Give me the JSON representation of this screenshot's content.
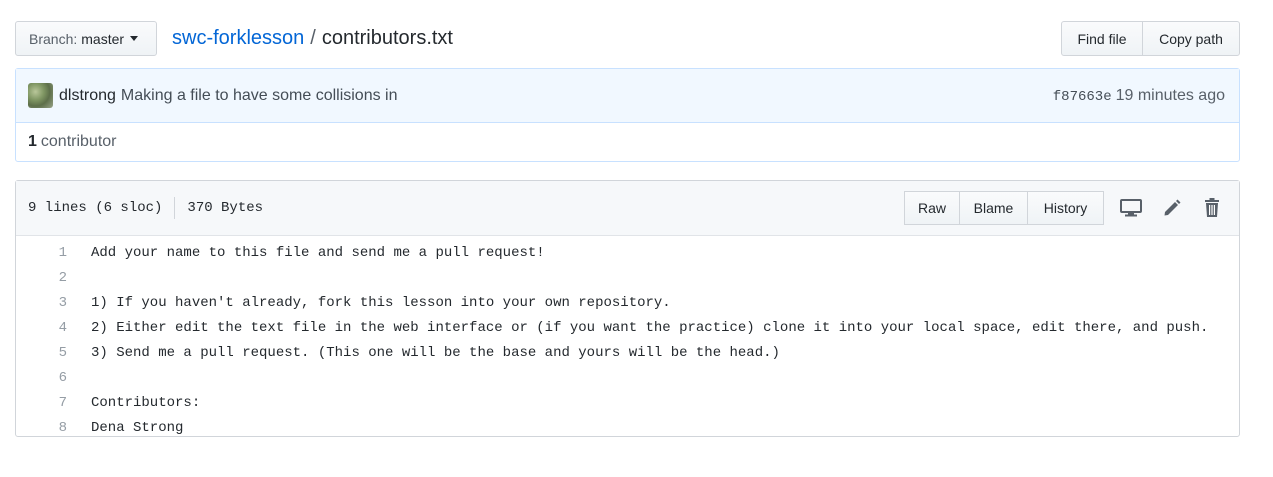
{
  "branch": {
    "label": "Branch:",
    "value": "master"
  },
  "breadcrumb": {
    "repo": "swc-forklesson",
    "separator": "/",
    "file": "contributors.txt"
  },
  "top_actions": {
    "find_file": "Find file",
    "copy_path": "Copy path"
  },
  "commit": {
    "author": "dlstrong",
    "message": "Making a file to have some collisions in",
    "sha": "f87663e",
    "time": "19 minutes ago"
  },
  "contributors": {
    "count": "1",
    "label": "contributor"
  },
  "file": {
    "lines_info": "9 lines (6 sloc)",
    "size": "370 Bytes",
    "actions": {
      "raw": "Raw",
      "blame": "Blame",
      "history": "History"
    },
    "icons": [
      "desktop-icon",
      "pencil-icon",
      "trash-icon"
    ],
    "lines": [
      {
        "num": "1",
        "text": "Add your name to this file and send me a pull request!"
      },
      {
        "num": "2",
        "text": ""
      },
      {
        "num": "3",
        "text": "1) If you haven't already, fork this lesson into your own repository."
      },
      {
        "num": "4",
        "text": "2) Either edit the text file in the web interface or (if you want the practice) clone it into your local space, edit there, and push."
      },
      {
        "num": "5",
        "text": "3) Send me a pull request. (This one will be the base and yours will be the head.)"
      },
      {
        "num": "6",
        "text": ""
      },
      {
        "num": "7",
        "text": "Contributors:"
      },
      {
        "num": "8",
        "text": "Dena Strong"
      }
    ]
  },
  "colors": {
    "link": "#0366d6",
    "commit_bg": "#f1f8ff",
    "commit_border": "#c8e1ff"
  }
}
